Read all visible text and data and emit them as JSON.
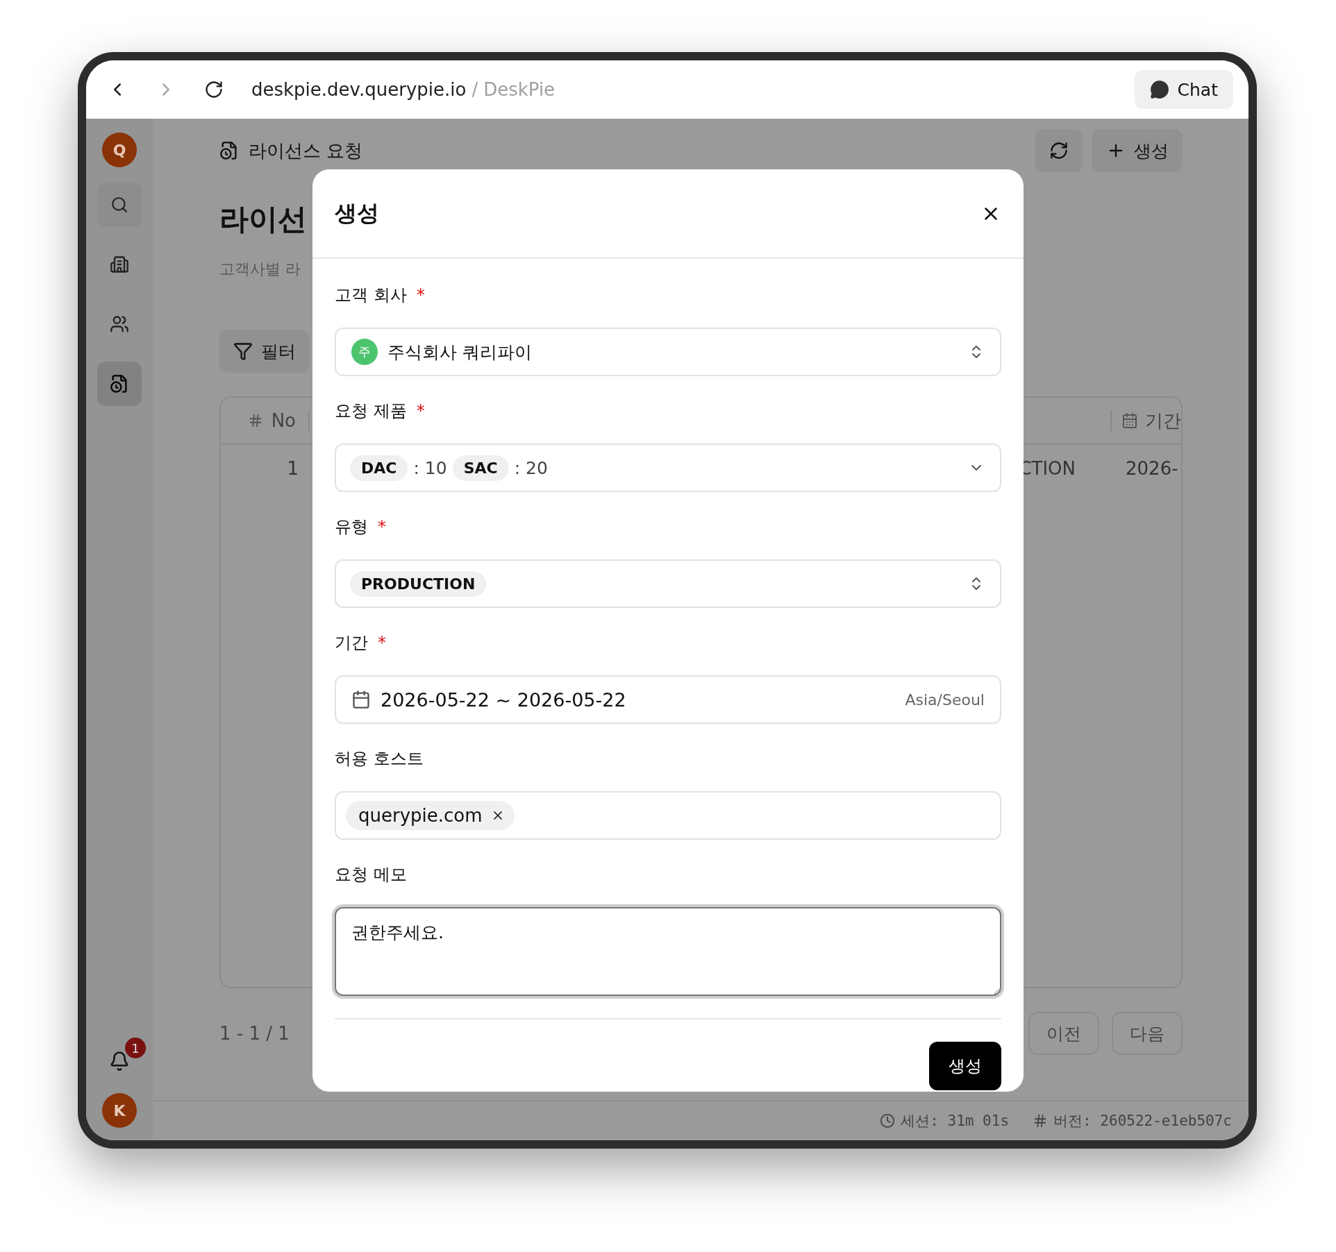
{
  "browser": {
    "host": "deskpie.dev.querypie.io",
    "separator": "/",
    "page_title": "DeskPie",
    "forward_disabled": true,
    "chat_button": "Chat"
  },
  "sidebar": {
    "top_avatar": "Q",
    "items": [
      {
        "kind": "search",
        "selected": false
      },
      {
        "kind": "building",
        "selected": false
      },
      {
        "kind": "users",
        "selected": false
      },
      {
        "kind": "license",
        "selected": true
      }
    ],
    "notification_count": "1",
    "bottom_avatar": "K"
  },
  "page": {
    "breadcrumb": "라이선스 요청",
    "create_button": "생성",
    "title": "라이선",
    "subtitle": "고객사별 라",
    "filter_button": "필터",
    "table": {
      "columns": [
        {
          "label": "No"
        },
        {
          "label": "기간"
        }
      ],
      "rows": [
        {
          "no": "1",
          "type": "CTION",
          "period": "2026-"
        }
      ]
    },
    "pagination": "1 - 1 / 1",
    "prev_button": "이전",
    "next_button": "다음"
  },
  "status_bar": {
    "session": "세션: 31m 01s",
    "version": "버전: 260522-e1eb507c"
  },
  "dialog": {
    "title": "생성",
    "fields": [
      {
        "kind": "company",
        "label": "고객 회사",
        "required_mark": "*",
        "badge": "주",
        "value": "주식회사 쿼리파이"
      },
      {
        "kind": "products",
        "label": "요청 제품",
        "required_mark": "*",
        "items": [
          {
            "name": "DAC",
            "count": ": 10"
          },
          {
            "name": "SAC",
            "count": ": 20"
          }
        ]
      },
      {
        "kind": "type",
        "label": "유형",
        "required_mark": "*",
        "value": "PRODUCTION"
      },
      {
        "kind": "period",
        "label": "기간",
        "required_mark": "*",
        "value": "2026-05-22 ~ 2026-05-22",
        "timezone": "Asia/Seoul"
      },
      {
        "kind": "hosts",
        "label": "허용 호스트",
        "tags": [
          "querypie.com"
        ]
      },
      {
        "kind": "memo",
        "label": "요청 메모",
        "value": "권한주세요.",
        "focused": true
      }
    ],
    "submit_button": "생성"
  }
}
